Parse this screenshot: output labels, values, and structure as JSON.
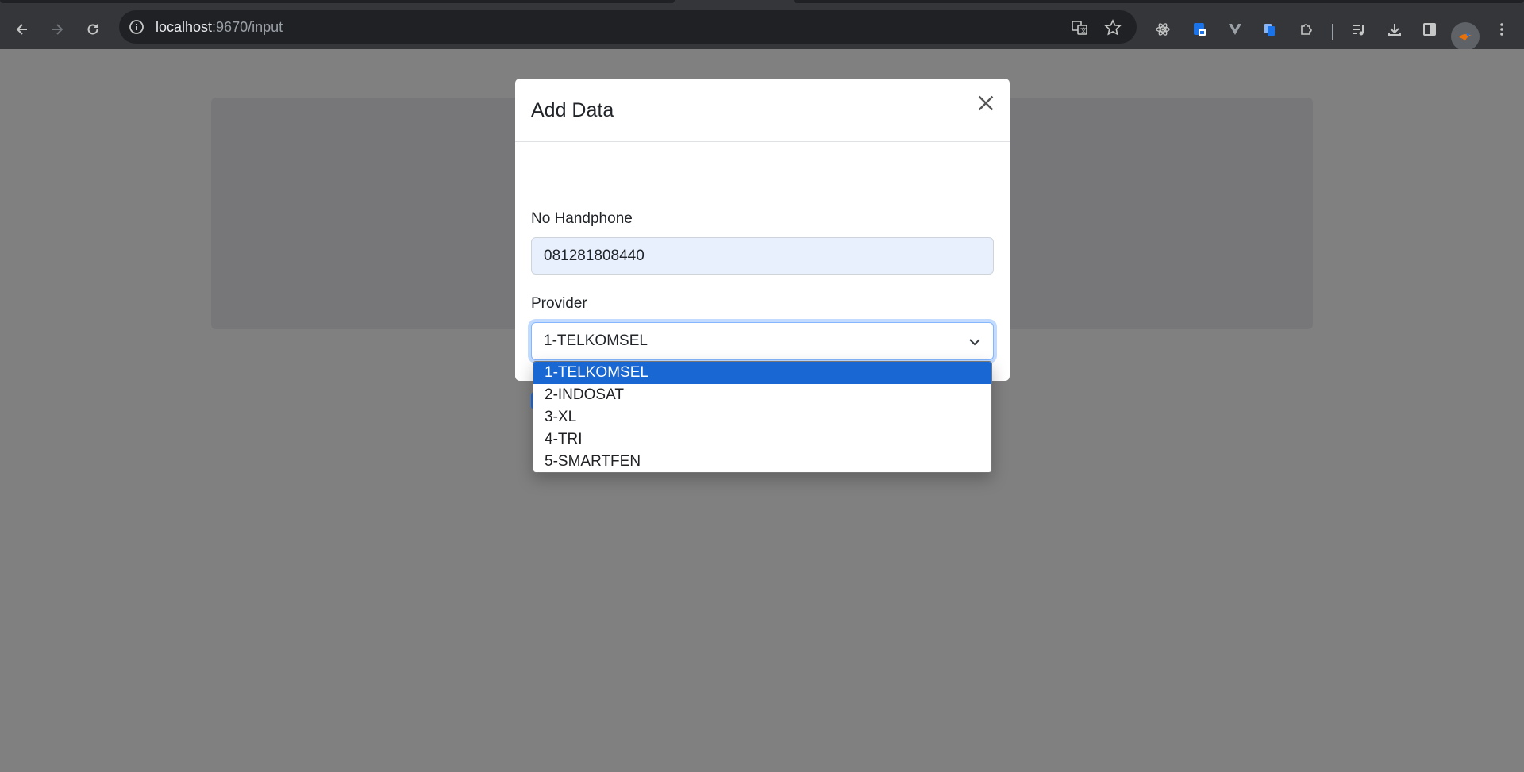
{
  "browser": {
    "url_host": "localhost",
    "url_rest": ":9670/input"
  },
  "modal": {
    "title": "Add Data",
    "phone_label": "No Handphone",
    "phone_value": "081281808440",
    "provider_label": "Provider",
    "provider_selected": "1-TELKOMSEL"
  },
  "dropdown": {
    "options": [
      "1-TELKOMSEL",
      "2-INDOSAT",
      "3-XL",
      "4-TRI",
      "5-SMARTFEN"
    ],
    "selected_index": 0
  },
  "colors": {
    "overlay": "#808080",
    "highlight": "#1967d2",
    "input_autofill": "#e8f0fe"
  }
}
